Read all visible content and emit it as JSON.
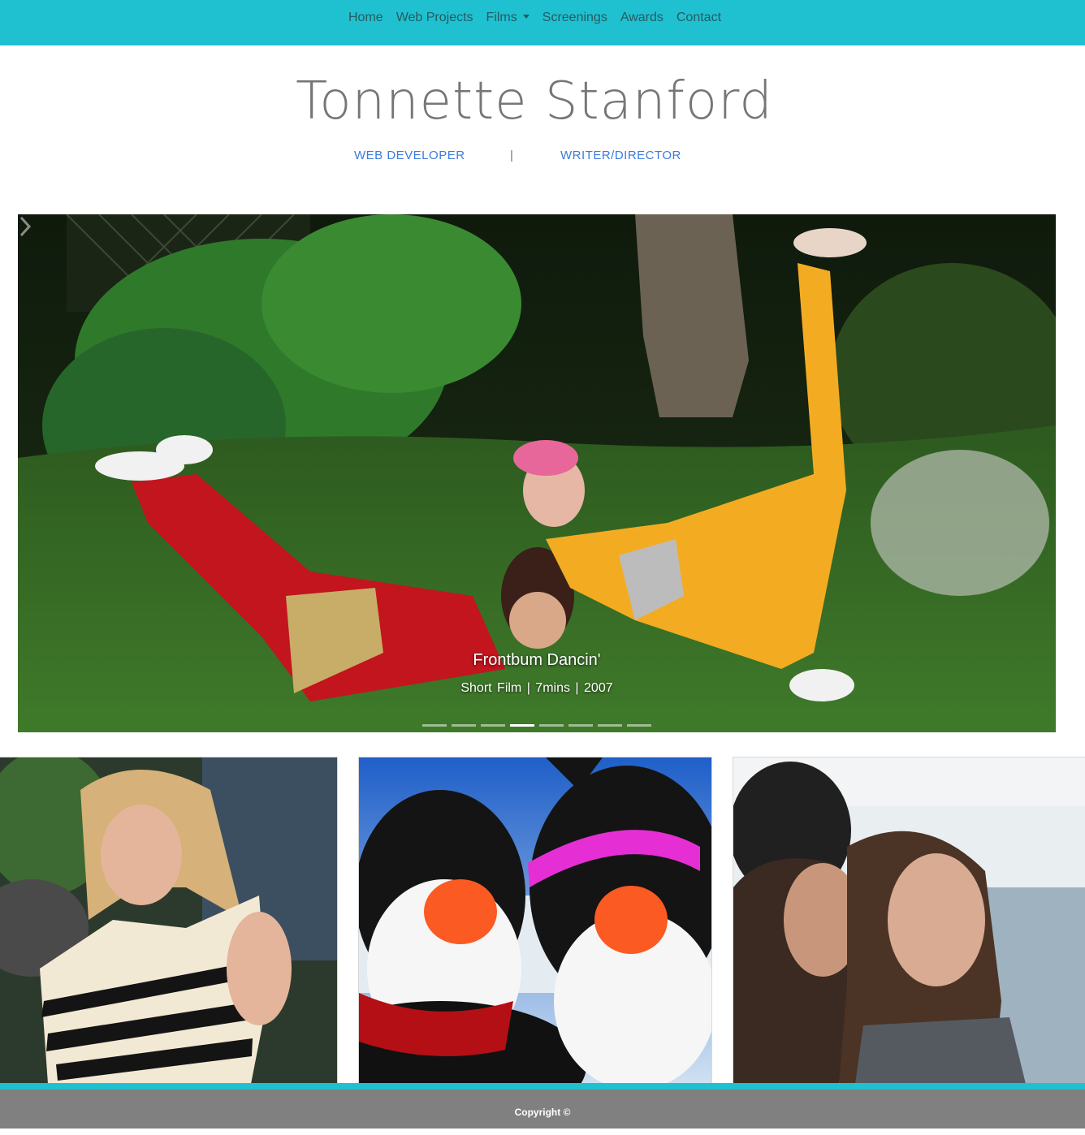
{
  "nav": {
    "items": [
      {
        "label": "Home"
      },
      {
        "label": "Web Projects"
      },
      {
        "label": "Films"
      },
      {
        "label": "Screenings"
      },
      {
        "label": "Awards"
      },
      {
        "label": "Contact"
      }
    ],
    "bg_color": "#1fc1d0",
    "text_color": "#275a62"
  },
  "header": {
    "title": "Tonnette Stanford",
    "role_web": "WEB DEVELOPER",
    "separator": "|",
    "role_film": "WRITER/DIRECTOR",
    "role_color": "#3b7be0"
  },
  "carousel": {
    "caption_title": "Frontbum Dancin'",
    "caption_meta": "Short Film  | 7mins  | 2007",
    "slide_count": 8,
    "active_slide": 4,
    "next_icon": "chevron-right-icon"
  },
  "thumbnails": [
    {
      "subject": "woman in striped top"
    },
    {
      "subject": "two cartoon penguins"
    },
    {
      "subject": "two women by the water"
    }
  ],
  "footer": {
    "copyright": "Copyright ©",
    "accent_color": "#1fc1d0",
    "bg_color": "#808080"
  }
}
